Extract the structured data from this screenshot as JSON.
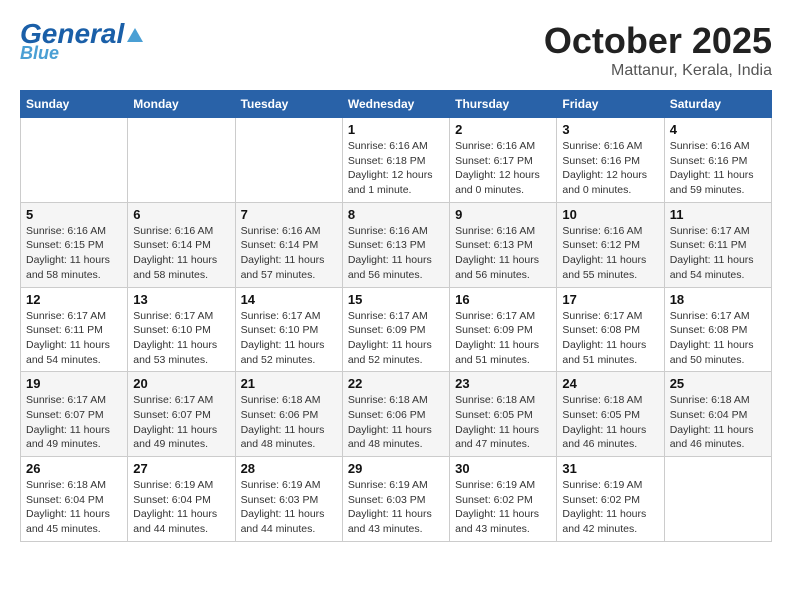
{
  "header": {
    "logo_general": "General",
    "logo_blue": "Blue",
    "month_title": "October 2025",
    "location": "Mattanur, Kerala, India"
  },
  "weekdays": [
    "Sunday",
    "Monday",
    "Tuesday",
    "Wednesday",
    "Thursday",
    "Friday",
    "Saturday"
  ],
  "weeks": [
    [
      {
        "day": "",
        "info": ""
      },
      {
        "day": "",
        "info": ""
      },
      {
        "day": "",
        "info": ""
      },
      {
        "day": "1",
        "info": "Sunrise: 6:16 AM\nSunset: 6:18 PM\nDaylight: 12 hours\nand 1 minute."
      },
      {
        "day": "2",
        "info": "Sunrise: 6:16 AM\nSunset: 6:17 PM\nDaylight: 12 hours\nand 0 minutes."
      },
      {
        "day": "3",
        "info": "Sunrise: 6:16 AM\nSunset: 6:16 PM\nDaylight: 12 hours\nand 0 minutes."
      },
      {
        "day": "4",
        "info": "Sunrise: 6:16 AM\nSunset: 6:16 PM\nDaylight: 11 hours\nand 59 minutes."
      }
    ],
    [
      {
        "day": "5",
        "info": "Sunrise: 6:16 AM\nSunset: 6:15 PM\nDaylight: 11 hours\nand 58 minutes."
      },
      {
        "day": "6",
        "info": "Sunrise: 6:16 AM\nSunset: 6:14 PM\nDaylight: 11 hours\nand 58 minutes."
      },
      {
        "day": "7",
        "info": "Sunrise: 6:16 AM\nSunset: 6:14 PM\nDaylight: 11 hours\nand 57 minutes."
      },
      {
        "day": "8",
        "info": "Sunrise: 6:16 AM\nSunset: 6:13 PM\nDaylight: 11 hours\nand 56 minutes."
      },
      {
        "day": "9",
        "info": "Sunrise: 6:16 AM\nSunset: 6:13 PM\nDaylight: 11 hours\nand 56 minutes."
      },
      {
        "day": "10",
        "info": "Sunrise: 6:16 AM\nSunset: 6:12 PM\nDaylight: 11 hours\nand 55 minutes."
      },
      {
        "day": "11",
        "info": "Sunrise: 6:17 AM\nSunset: 6:11 PM\nDaylight: 11 hours\nand 54 minutes."
      }
    ],
    [
      {
        "day": "12",
        "info": "Sunrise: 6:17 AM\nSunset: 6:11 PM\nDaylight: 11 hours\nand 54 minutes."
      },
      {
        "day": "13",
        "info": "Sunrise: 6:17 AM\nSunset: 6:10 PM\nDaylight: 11 hours\nand 53 minutes."
      },
      {
        "day": "14",
        "info": "Sunrise: 6:17 AM\nSunset: 6:10 PM\nDaylight: 11 hours\nand 52 minutes."
      },
      {
        "day": "15",
        "info": "Sunrise: 6:17 AM\nSunset: 6:09 PM\nDaylight: 11 hours\nand 52 minutes."
      },
      {
        "day": "16",
        "info": "Sunrise: 6:17 AM\nSunset: 6:09 PM\nDaylight: 11 hours\nand 51 minutes."
      },
      {
        "day": "17",
        "info": "Sunrise: 6:17 AM\nSunset: 6:08 PM\nDaylight: 11 hours\nand 51 minutes."
      },
      {
        "day": "18",
        "info": "Sunrise: 6:17 AM\nSunset: 6:08 PM\nDaylight: 11 hours\nand 50 minutes."
      }
    ],
    [
      {
        "day": "19",
        "info": "Sunrise: 6:17 AM\nSunset: 6:07 PM\nDaylight: 11 hours\nand 49 minutes."
      },
      {
        "day": "20",
        "info": "Sunrise: 6:17 AM\nSunset: 6:07 PM\nDaylight: 11 hours\nand 49 minutes."
      },
      {
        "day": "21",
        "info": "Sunrise: 6:18 AM\nSunset: 6:06 PM\nDaylight: 11 hours\nand 48 minutes."
      },
      {
        "day": "22",
        "info": "Sunrise: 6:18 AM\nSunset: 6:06 PM\nDaylight: 11 hours\nand 48 minutes."
      },
      {
        "day": "23",
        "info": "Sunrise: 6:18 AM\nSunset: 6:05 PM\nDaylight: 11 hours\nand 47 minutes."
      },
      {
        "day": "24",
        "info": "Sunrise: 6:18 AM\nSunset: 6:05 PM\nDaylight: 11 hours\nand 46 minutes."
      },
      {
        "day": "25",
        "info": "Sunrise: 6:18 AM\nSunset: 6:04 PM\nDaylight: 11 hours\nand 46 minutes."
      }
    ],
    [
      {
        "day": "26",
        "info": "Sunrise: 6:18 AM\nSunset: 6:04 PM\nDaylight: 11 hours\nand 45 minutes."
      },
      {
        "day": "27",
        "info": "Sunrise: 6:19 AM\nSunset: 6:04 PM\nDaylight: 11 hours\nand 44 minutes."
      },
      {
        "day": "28",
        "info": "Sunrise: 6:19 AM\nSunset: 6:03 PM\nDaylight: 11 hours\nand 44 minutes."
      },
      {
        "day": "29",
        "info": "Sunrise: 6:19 AM\nSunset: 6:03 PM\nDaylight: 11 hours\nand 43 minutes."
      },
      {
        "day": "30",
        "info": "Sunrise: 6:19 AM\nSunset: 6:02 PM\nDaylight: 11 hours\nand 43 minutes."
      },
      {
        "day": "31",
        "info": "Sunrise: 6:19 AM\nSunset: 6:02 PM\nDaylight: 11 hours\nand 42 minutes."
      },
      {
        "day": "",
        "info": ""
      }
    ]
  ]
}
